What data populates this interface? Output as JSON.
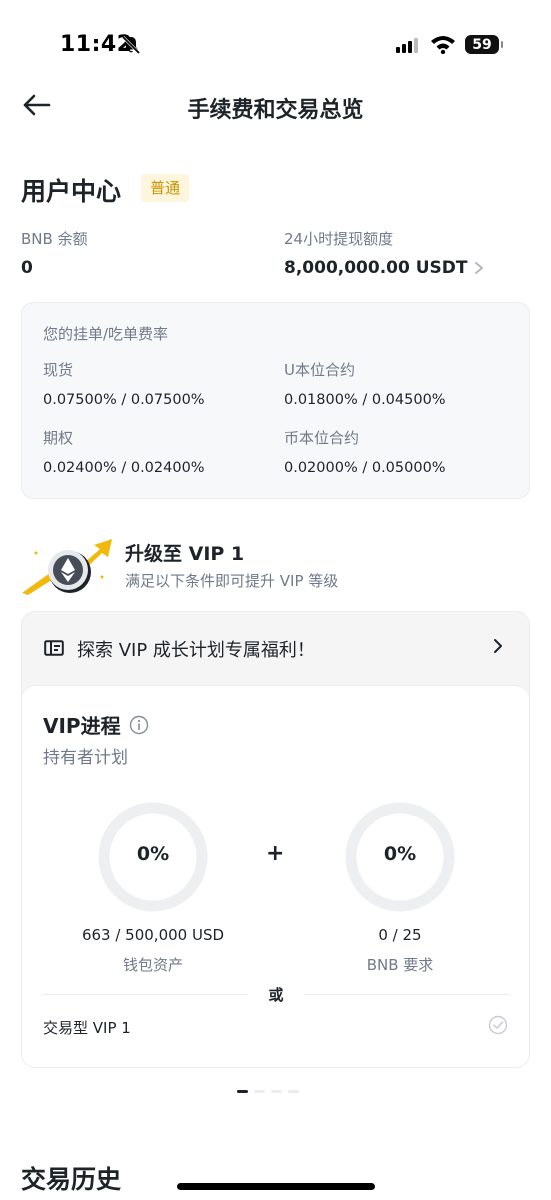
{
  "status_bar": {
    "time": "11:42",
    "battery": "59"
  },
  "header": {
    "title": "手续费和交易总览"
  },
  "user_center": {
    "title": "用户中心",
    "badge": "普通",
    "bnb_balance_label": "BNB 余额",
    "bnb_balance_value": "0",
    "withdraw_limit_label": "24小时提现额度",
    "withdraw_limit_value": "8,000,000.00 USDT"
  },
  "fees": {
    "header": "您的挂单/吃单费率",
    "items": [
      {
        "label": "现货",
        "value": "0.07500% / 0.07500%"
      },
      {
        "label": "U本位合约",
        "value": "0.01800% / 0.04500%"
      },
      {
        "label": "期权",
        "value": "0.02400% / 0.02400%"
      },
      {
        "label": "币本位合约",
        "value": "0.02000% / 0.05000%"
      }
    ]
  },
  "upgrade": {
    "title": "升级至 VIP 1",
    "subtitle": "满足以下条件即可提升 VIP 等级"
  },
  "vip": {
    "explore_text": "探索 VIP 成长计划专属福利！",
    "progress_title": "VIP进程",
    "plan": "持有者计划",
    "plus": "+",
    "wallet": {
      "percent": "0%",
      "value": "663 / 500,000 USD",
      "label": "钱包资产",
      "progress": 0
    },
    "bnb": {
      "percent": "0%",
      "value": "0 / 25",
      "label": "BNB 要求",
      "progress": 0
    },
    "or_text": "或",
    "trading_vip": "交易型 VIP 1"
  },
  "pager": {
    "count": 4,
    "active": 0
  },
  "history": {
    "title": "交易历史"
  },
  "colors": {
    "accent": "#f0b90b",
    "badge_text": "#c99400",
    "badge_bg": "#fdf6dc",
    "text_primary": "#1e2329",
    "text_secondary": "#707a8a"
  }
}
